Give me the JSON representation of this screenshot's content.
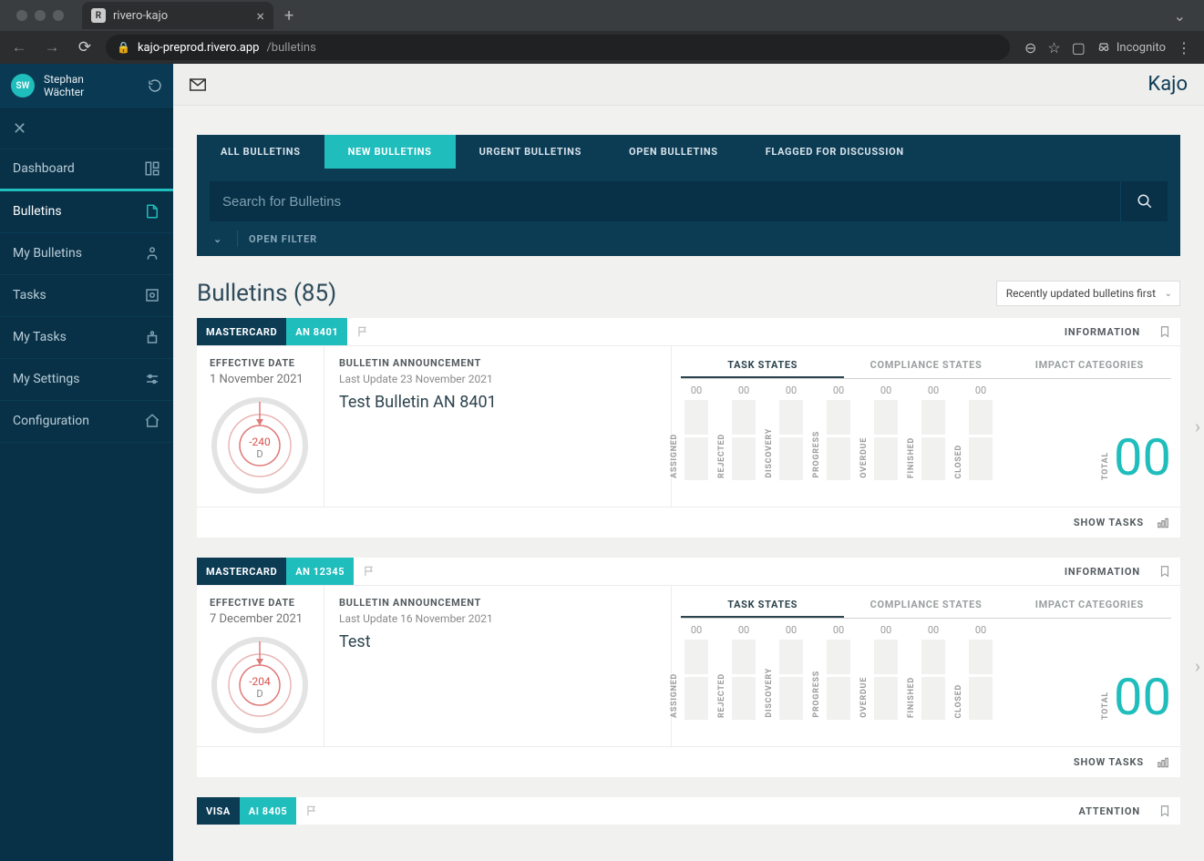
{
  "browser": {
    "tab_title": "rivero-kajo",
    "url_domain": "kajo-preprod.rivero.app",
    "url_path": "/bulletins",
    "incognito_label": "Incognito"
  },
  "user": {
    "initials": "SW",
    "name_line1": "Stephan",
    "name_line2": "Wächter"
  },
  "nav": {
    "dashboard": "Dashboard",
    "bulletins": "Bulletins",
    "my_bulletins": "My Bulletins",
    "tasks": "Tasks",
    "my_tasks": "My Tasks",
    "my_settings": "My Settings",
    "configuration": "Configuration"
  },
  "brand": "Kajo",
  "tabs": {
    "all": "ALL BULLETINS",
    "new": "NEW BULLETINS",
    "urgent": "URGENT BULLETINS",
    "open": "OPEN BULLETINS",
    "flagged": "FLAGGED FOR DISCUSSION"
  },
  "search": {
    "placeholder": "Search for Bulletins"
  },
  "open_filter": "OPEN FILTER",
  "list_title": "Bulletins (85)",
  "sort_label": "Recently updated bulletins first",
  "labels": {
    "effective_date": "EFFECTIVE DATE",
    "bulletin_announcement": "BULLETIN ANNOUNCEMENT",
    "information": "INFORMATION",
    "attention": "ATTENTION",
    "task_states": "TASK STATES",
    "compliance_states": "COMPLIANCE STATES",
    "impact_categories": "IMPACT CATEGORIES",
    "show_tasks": "SHOW TASKS",
    "total": "TOTAL",
    "last_update_prefix": "Last Update "
  },
  "state_labels": [
    "ASSIGNED",
    "REJECTED",
    "DISCOVERY",
    "PROGRESS",
    "OVERDUE",
    "FINISHED",
    "CLOSED"
  ],
  "bulletins": [
    {
      "scheme": "MASTERCARD",
      "code": "AN 8401",
      "effective_date": "1 November 2021",
      "last_update": "23 November 2021",
      "title": "Test Bulletin AN 8401",
      "dial_value": "-240",
      "dial_unit": "D",
      "state_counts": [
        "00",
        "00",
        "00",
        "00",
        "00",
        "00",
        "00"
      ],
      "total": "00",
      "right_label": "INFORMATION"
    },
    {
      "scheme": "MASTERCARD",
      "code": "AN 12345",
      "effective_date": "7 December 2021",
      "last_update": "16 November 2021",
      "title": "Test",
      "dial_value": "-204",
      "dial_unit": "D",
      "state_counts": [
        "00",
        "00",
        "00",
        "00",
        "00",
        "00",
        "00"
      ],
      "total": "00",
      "right_label": "INFORMATION"
    },
    {
      "scheme": "VISA",
      "code": "AI 8405",
      "right_label": "ATTENTION"
    }
  ]
}
